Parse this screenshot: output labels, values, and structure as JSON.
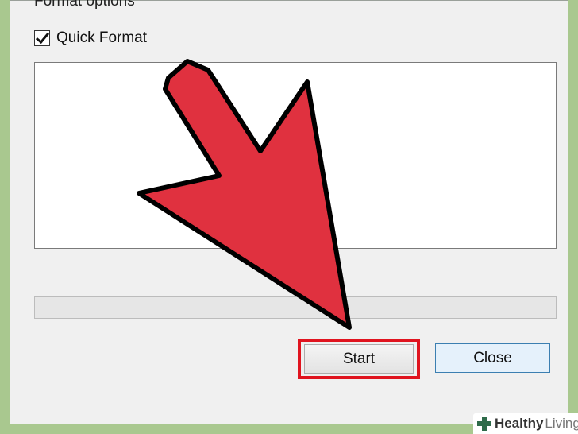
{
  "format_options": {
    "group_title": "Format options",
    "quick_format": {
      "label": "Quick Format",
      "checked": true
    }
  },
  "progress": {
    "value": 0
  },
  "buttons": {
    "start": "Start",
    "close": "Close"
  },
  "annotations": {
    "arrow_color": "#e0313f",
    "highlight_color": "#e0141f"
  },
  "watermark": {
    "word1": "Healthy",
    "word2": "Living",
    "icon": "plus-cross-icon"
  }
}
